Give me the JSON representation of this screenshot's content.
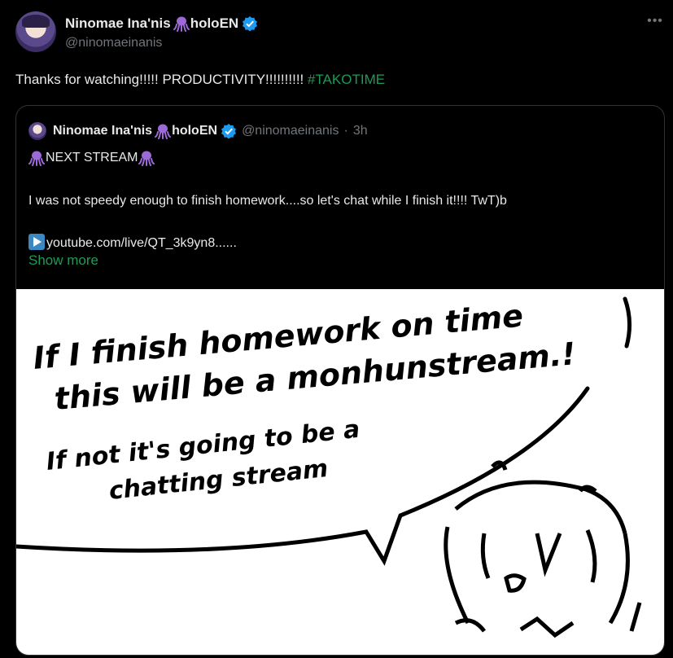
{
  "author": {
    "display_name": "Ninomae Ina'nis",
    "suffix": "holoEN",
    "handle": "@ninomaeinanis",
    "avatar_icon": "ina-avatar",
    "octopus_emoji": "octopus-icon",
    "verified_icon": "verified-badge-icon"
  },
  "tweet": {
    "text": "Thanks for watching!!!!! PRODUCTIVITY!!!!!!!!!! ",
    "hashtag": "#TAKOTIME",
    "more_icon": "more-options-icon"
  },
  "quote": {
    "display_name": "Ninomae Ina'nis",
    "suffix": "holoEN",
    "handle": "@ninomaeinanis",
    "separator": "·",
    "time": "3h",
    "title": "NEXT STREAM",
    "body": "I was not speedy enough to finish homework....so let's chat while I finish it!!!! TwT)b",
    "link": "youtube.com/live/QT_3k9yn8......",
    "show_more": "Show more",
    "image": {
      "description_icon": "drawing-image",
      "lines": [
        "If I finish homework on time",
        "this will be a monhunstream.!",
        "If not it's going to be a",
        "chatting stream"
      ]
    }
  },
  "colors": {
    "background": "#000000",
    "text": "#e7e9ea",
    "muted": "#71767b",
    "accent": "#1d9b57",
    "verified": "#1d9bf0",
    "octopus": "#9c6ad6"
  }
}
